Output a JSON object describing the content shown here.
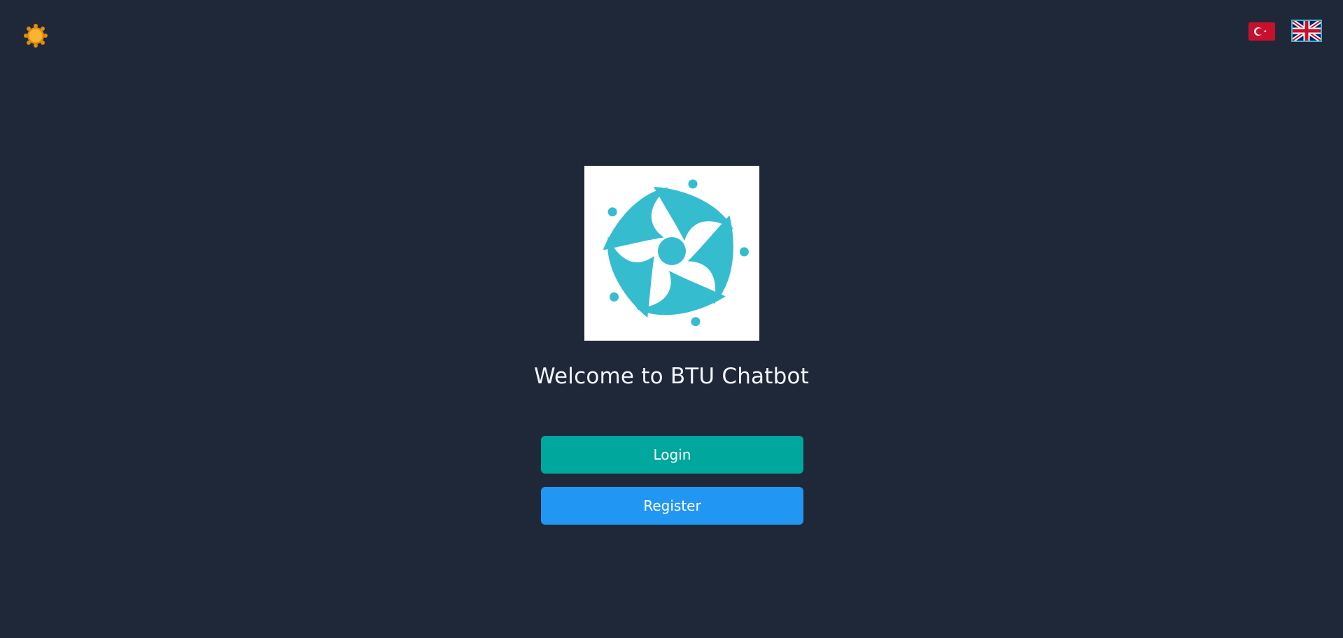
{
  "header": {
    "theme_toggle_icon": "sun-icon",
    "languages": [
      {
        "code": "tr",
        "icon": "turkey-flag-icon"
      },
      {
        "code": "en",
        "icon": "uk-flag-icon"
      }
    ]
  },
  "main": {
    "logo_icon": "btu-logo",
    "welcome_title": "Welcome to BTU Chatbot",
    "login_label": "Login",
    "register_label": "Register"
  },
  "colors": {
    "background": "#1f2839",
    "logo_accent": "#36bccf",
    "login_button": "#00a79d",
    "register_button": "#2196f3"
  }
}
